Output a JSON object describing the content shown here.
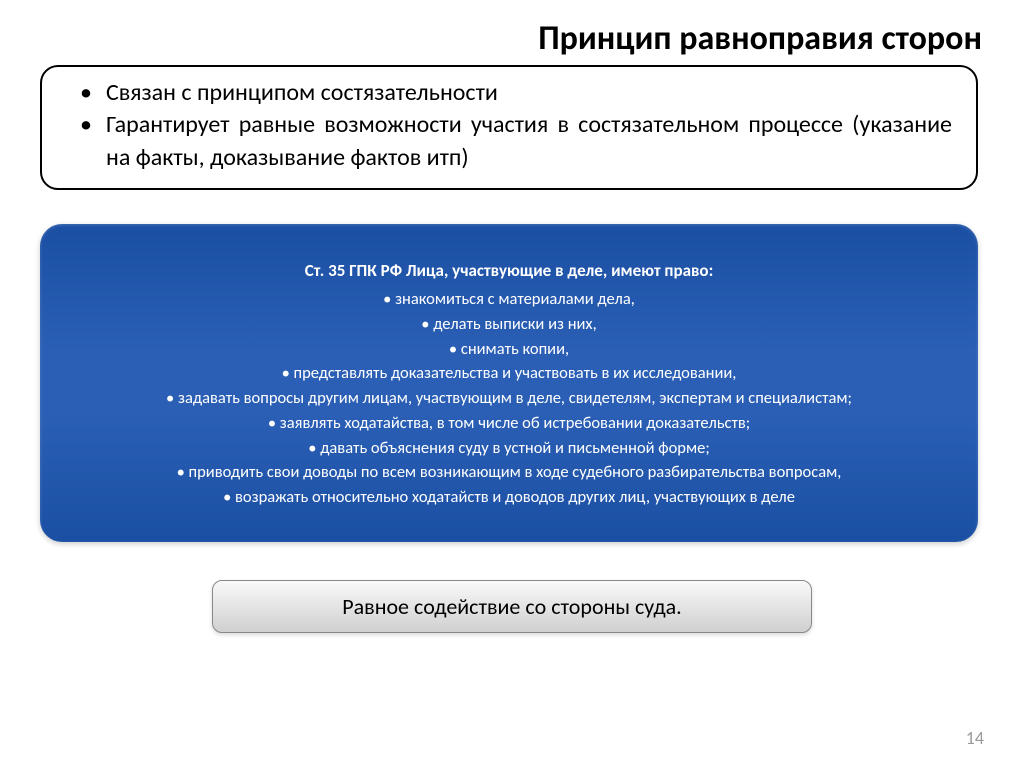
{
  "title": "Принцип равноправия сторон",
  "whiteBox": {
    "items": [
      "Связан с принципом состязательности",
      "Гарантирует равные возможности участия в состязательном процессе (указание на факты, доказывание фактов итп)"
    ]
  },
  "blueBox": {
    "heading": "Ст. 35 ГПК РФ Лица, участвующие в деле, имеют право:",
    "items": [
      "знакомиться с материалами дела,",
      "делать выписки из них,",
      "снимать копии,",
      "представлять доказательства и участвовать в их исследовании,",
      "задавать вопросы другим лицам, участвующим в деле, свидетелям, экспертам и специалистам;",
      "заявлять ходатайства, в том числе об истребовании доказательств;",
      "давать объяснения суду в устной и письменной форме;",
      "приводить свои доводы по всем возникающим в ходе судебного разбирательства вопросам,",
      "возражать относительно ходатайств и доводов других лиц, участвующих в деле"
    ]
  },
  "grayBox": {
    "text": "Равное содействие со стороны суда."
  },
  "pageNumber": "14"
}
